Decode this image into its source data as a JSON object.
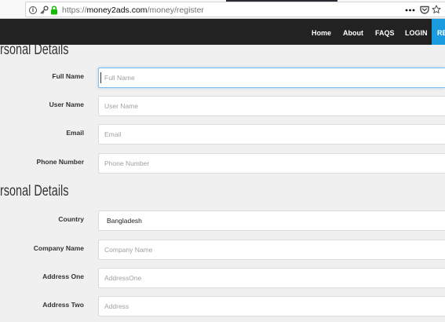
{
  "browser": {
    "url": {
      "scheme": "https://",
      "domain": "money2ads.com",
      "path": "/money/register"
    },
    "icons": [
      "info-icon",
      "key-icon",
      "lock-icon",
      "more-actions-icon",
      "pocket-icon",
      "bookmark-star-icon"
    ]
  },
  "nav": {
    "items": [
      {
        "label": "Home"
      },
      {
        "label": "About"
      },
      {
        "label": "FAQS"
      },
      {
        "label": "LOGIN"
      }
    ],
    "cta_label": "RE"
  },
  "sections": [
    {
      "heading": "rsonal Details",
      "fields": [
        {
          "label": "Full Name",
          "placeholder": "Full Name",
          "focused": true
        },
        {
          "label": "User Name",
          "placeholder": "User Name"
        },
        {
          "label": "Email",
          "placeholder": "Email"
        },
        {
          "label": "Phone Number",
          "placeholder": "Phone Number"
        }
      ]
    },
    {
      "heading": "rsonal Details",
      "fields": [
        {
          "label": "Country",
          "selected": "Bangladesh"
        },
        {
          "label": "Company Name",
          "placeholder": "Company Name"
        },
        {
          "label": "Address One",
          "placeholder": "AddressOne"
        },
        {
          "label": "Address Two",
          "placeholder": "Address"
        }
      ]
    }
  ],
  "colors": {
    "nav_bg": "#222222",
    "page_bg": "#f0f0f0",
    "accent": "#1c9ce0",
    "focus_border": "#7fbdf0",
    "label_text": "#333333",
    "placeholder_text": "#a0a0a0",
    "lock_green": "#12bc00"
  }
}
